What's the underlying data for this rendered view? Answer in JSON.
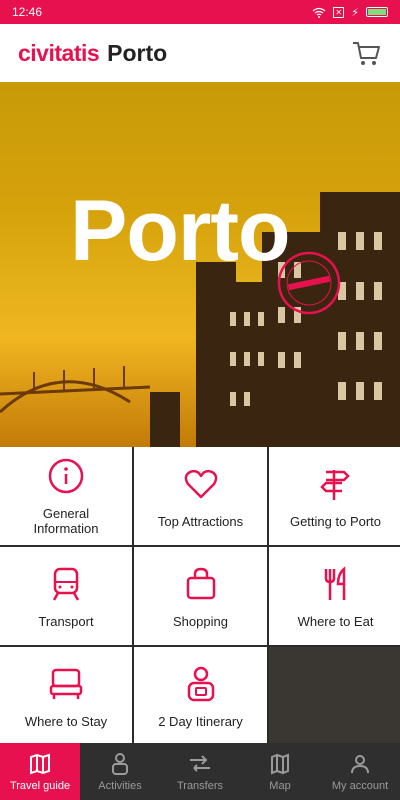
{
  "status_bar": {
    "time": "12:46"
  },
  "app_bar": {
    "brand": "civitatis",
    "city": "Porto"
  },
  "hero": {
    "title": "Porto",
    "badge": "TOP DESTINATION · CIVITATIS"
  },
  "tiles": [
    {
      "label": "General\nInformation",
      "icon": "info-icon"
    },
    {
      "label": "Top Attractions",
      "icon": "heart-icon"
    },
    {
      "label": "Getting to Porto",
      "icon": "signpost-icon"
    },
    {
      "label": "Transport",
      "icon": "train-icon"
    },
    {
      "label": "Shopping",
      "icon": "shopping-bag-icon"
    },
    {
      "label": "Where to Eat",
      "icon": "cutlery-icon"
    },
    {
      "label": "Where to Stay",
      "icon": "bed-icon"
    },
    {
      "label": "2 Day Itinerary",
      "icon": "guide-icon"
    }
  ],
  "bottom_nav": [
    {
      "label": "Travel guide",
      "icon": "map-icon",
      "active": true
    },
    {
      "label": "Activities",
      "icon": "activities-icon",
      "active": false
    },
    {
      "label": "Transfers",
      "icon": "transfer-icon",
      "active": false
    },
    {
      "label": "Map",
      "icon": "map-pin-icon",
      "active": false
    },
    {
      "label": "My account",
      "icon": "user-icon",
      "active": false
    }
  ],
  "colors": {
    "accent": "#e8114f"
  }
}
